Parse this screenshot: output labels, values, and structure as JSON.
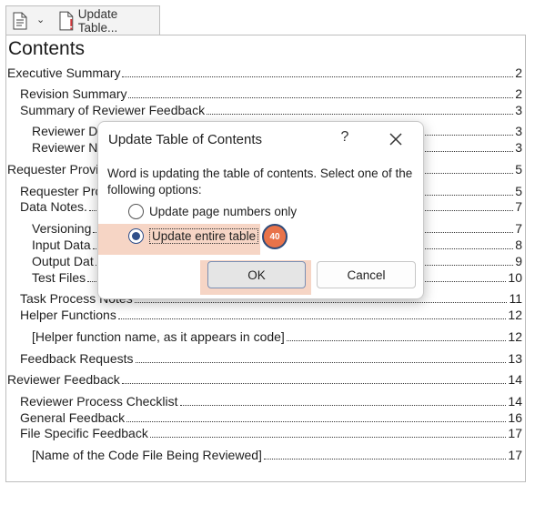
{
  "toolbar": {
    "doc_icon": "document-lines-icon",
    "dropdown_icon": "chevron-down-icon",
    "update_icon": "document-exclamation-icon",
    "update_label": "Update Table..."
  },
  "toc": {
    "title": "Contents",
    "entries": [
      {
        "text": "Executive Summary",
        "page": "2"
      },
      {
        "text": "Revision Summary",
        "page": "2"
      },
      {
        "text": "Summary of Reviewer Feedback",
        "page": "3"
      },
      {
        "text": "Reviewer D",
        "page": "3"
      },
      {
        "text": "Reviewer N",
        "page": "3"
      },
      {
        "text": "Requester Provi",
        "page": "5"
      },
      {
        "text": "Requester Pro",
        "page": "5"
      },
      {
        "text": "Data Notes.",
        "page": "7"
      },
      {
        "text": "Versioning",
        "page": "7"
      },
      {
        "text": "Input Data",
        "page": "8"
      },
      {
        "text": "Output Dat",
        "page": "9"
      },
      {
        "text": "Test Files",
        "page": "10"
      },
      {
        "text": "Task Process Notes",
        "page": "11"
      },
      {
        "text": "Helper Functions",
        "page": "12"
      },
      {
        "text": "[Helper function name, as it appears in code]",
        "page": "12"
      },
      {
        "text": "Feedback Requests",
        "page": "13"
      },
      {
        "text": "Reviewer Feedback",
        "page": "14"
      },
      {
        "text": "Reviewer Process Checklist",
        "page": "14"
      },
      {
        "text": "General Feedback",
        "page": "16"
      },
      {
        "text": "File Specific Feedback",
        "page": "17"
      },
      {
        "text": "[Name of the Code File Being Reviewed]",
        "page": "17"
      }
    ]
  },
  "dialog": {
    "title": "Update Table of Contents",
    "help": "?",
    "close_icon": "close-icon",
    "message": "Word is updating the table of contents.  Select one of the following options:",
    "options": [
      {
        "label": "Update page numbers only",
        "selected": false
      },
      {
        "label": "Update entire table",
        "selected": true
      }
    ],
    "ok_label": "OK",
    "cancel_label": "Cancel"
  },
  "annotation": {
    "step_number": "40",
    "highlight_color": "#f6d5c5",
    "badge_color": "#e8734a"
  }
}
